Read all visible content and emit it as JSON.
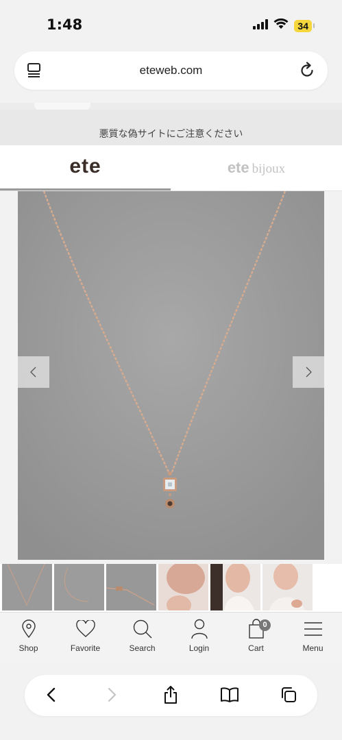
{
  "status_bar": {
    "time": "1:48",
    "battery": "34",
    "icons": [
      "signal-icon",
      "wifi-icon",
      "battery-icon"
    ]
  },
  "browser": {
    "url": "eteweb.com",
    "tabs_icon": "tab-overview-icon",
    "reload_icon": "reload-icon"
  },
  "warning": {
    "text": "悪質な偽サイトにご注意ください"
  },
  "brand_tabs": {
    "active": "ete",
    "ete_label": "ete",
    "bijoux_prefix": "ete",
    "bijoux_suffix": "bijoux"
  },
  "gallery": {
    "main_image": "necklace-product-photo",
    "prev_icon": "chevron-left-icon",
    "next_icon": "chevron-right-icon",
    "thumbnails": [
      "necklace-thumb-1",
      "necklace-thumb-2",
      "necklace-thumb-3",
      "model-thumb-4",
      "model-thumb-5",
      "model-thumb-6"
    ]
  },
  "bottom_nav": {
    "items": [
      {
        "label": "Shop",
        "icon": "map-pin-icon"
      },
      {
        "label": "Favorite",
        "icon": "heart-icon"
      },
      {
        "label": "Search",
        "icon": "search-icon"
      },
      {
        "label": "Login",
        "icon": "user-icon"
      },
      {
        "label": "Cart",
        "icon": "bag-icon",
        "badge": "0"
      },
      {
        "label": "Menu",
        "icon": "menu-icon"
      }
    ]
  },
  "safari_toolbar": [
    "back-icon",
    "forward-icon",
    "share-icon",
    "bookmarks-icon",
    "tabs-icon"
  ],
  "colors": {
    "brand": "#3a2d28",
    "image_bg": "#9c9c9c",
    "chain": "#d6ab90",
    "battery": "#f5d73d"
  }
}
